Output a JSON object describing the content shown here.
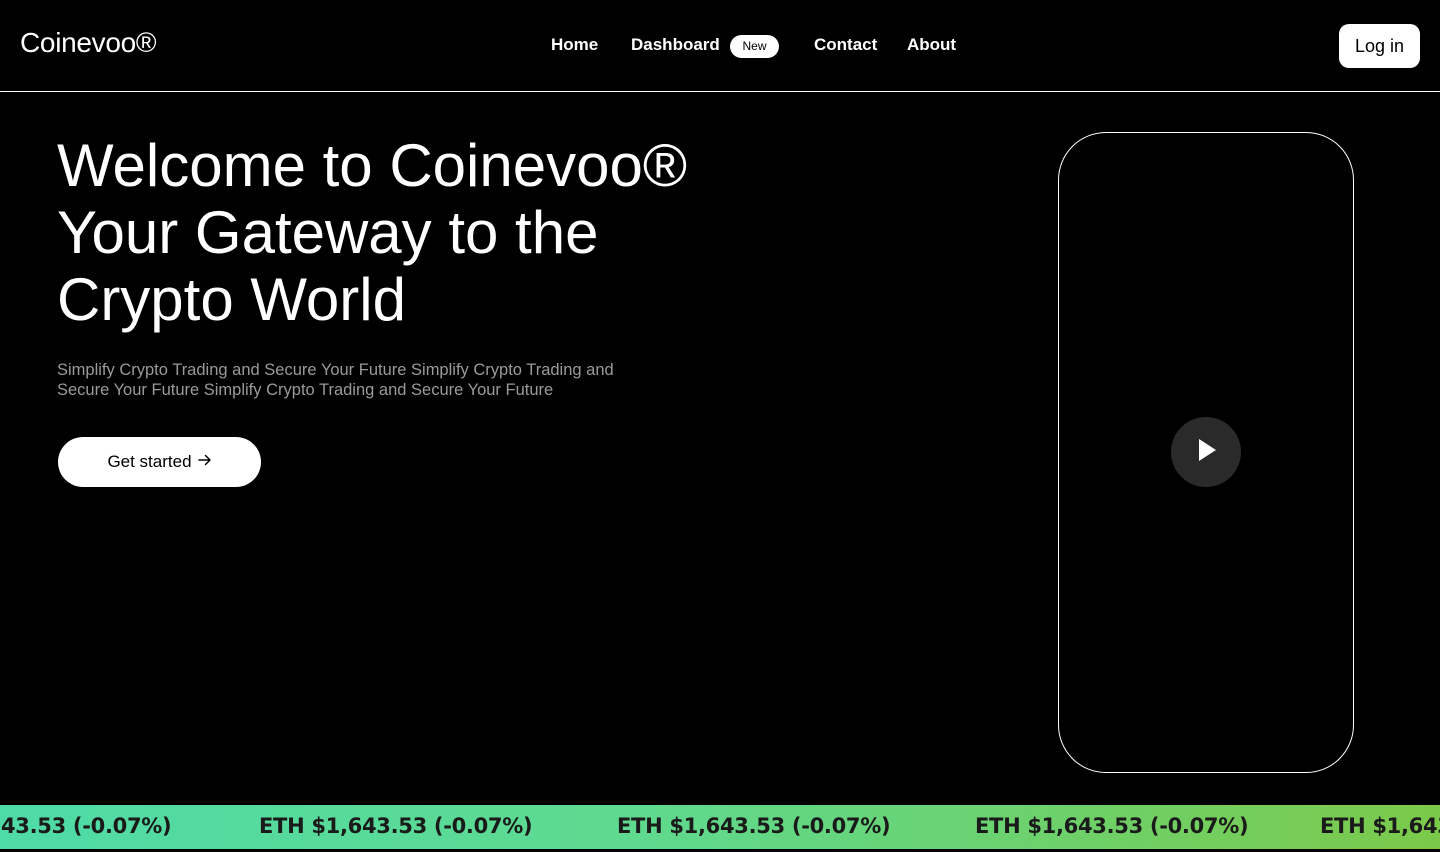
{
  "brand": {
    "name": "Coinevoo®"
  },
  "nav": {
    "links": [
      "Home",
      "Dashboard",
      "Contact",
      "About"
    ],
    "dashboard_badge": "New",
    "login_label": "Log in"
  },
  "hero": {
    "title_lines": [
      "Welcome to Coinevoo®",
      "Your Gateway to the",
      "Crypto World"
    ],
    "subtitle": "Simplify Crypto Trading and Secure Your Future Simplify Crypto Trading and Secure Your Future Simplify Crypto Trading and Secure Your Future",
    "cta_label": "Get started",
    "cta_icon": "arrow-right-icon"
  },
  "video": {
    "play_icon": "play-icon"
  },
  "ticker": {
    "items": [
      "43.53 (-0.07%)",
      "ETH $1,643.53 (-0.07%)",
      "ETH $1,643.53 (-0.07%)",
      "ETH $1,643.53 (-0.07%)",
      "ETH $1,643"
    ]
  },
  "colors": {
    "background": "#000000",
    "ticker_gradient_start": "#4fdba7",
    "ticker_gradient_end": "#7bc94a",
    "play_button": "#2a2a2a"
  }
}
